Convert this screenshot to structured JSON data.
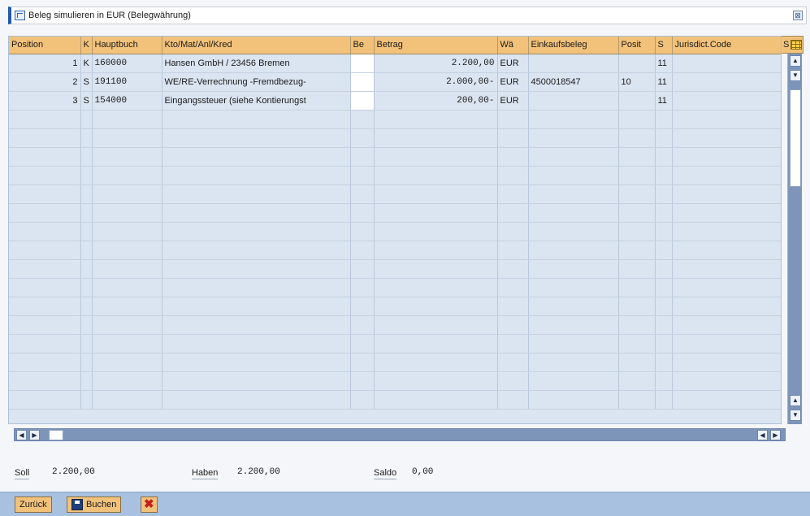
{
  "window": {
    "title": "Beleg simulieren in EUR (Belegwährung)"
  },
  "grid": {
    "columns": [
      "Position",
      "K",
      "Hauptbuch",
      "Kto/Mat/Anl/Kred",
      "Be",
      "Betrag",
      "Wä",
      "Einkaufsbeleg",
      "Posit",
      "S",
      "Jurisdict.Code"
    ],
    "last_column_header": "S",
    "rows": [
      {
        "position": "1",
        "k": "K",
        "hauptbuch": "160000",
        "kto": "Hansen GmbH / 23456 Bremen",
        "be": "",
        "betrag": "2.200,00",
        "wae": "EUR",
        "einkaufsbeleg": "",
        "posit": "",
        "s": "11",
        "juris": ""
      },
      {
        "position": "2",
        "k": "S",
        "hauptbuch": "191100",
        "kto": "WE/RE-Verrechnung -Fremdbezug-",
        "be": "",
        "betrag": "2.000,00-",
        "wae": "EUR",
        "einkaufsbeleg": "4500018547",
        "posit": "10",
        "s": "11",
        "juris": ""
      },
      {
        "position": "3",
        "k": "S",
        "hauptbuch": "154000",
        "kto": "Eingangssteuer (siehe Kontierungst",
        "be": "",
        "betrag": "200,00-",
        "wae": "EUR",
        "einkaufsbeleg": "",
        "posit": "",
        "s": "11",
        "juris": ""
      }
    ]
  },
  "totals": {
    "soll_label": "Soll",
    "soll_value": "2.200,00",
    "haben_label": "Haben",
    "haben_value": "2.200,00",
    "saldo_label": "Saldo",
    "saldo_value": "0,00"
  },
  "toolbar": {
    "back_label": "Zurück",
    "post_label": "Buchen",
    "cancel_icon": "cancel-icon"
  }
}
